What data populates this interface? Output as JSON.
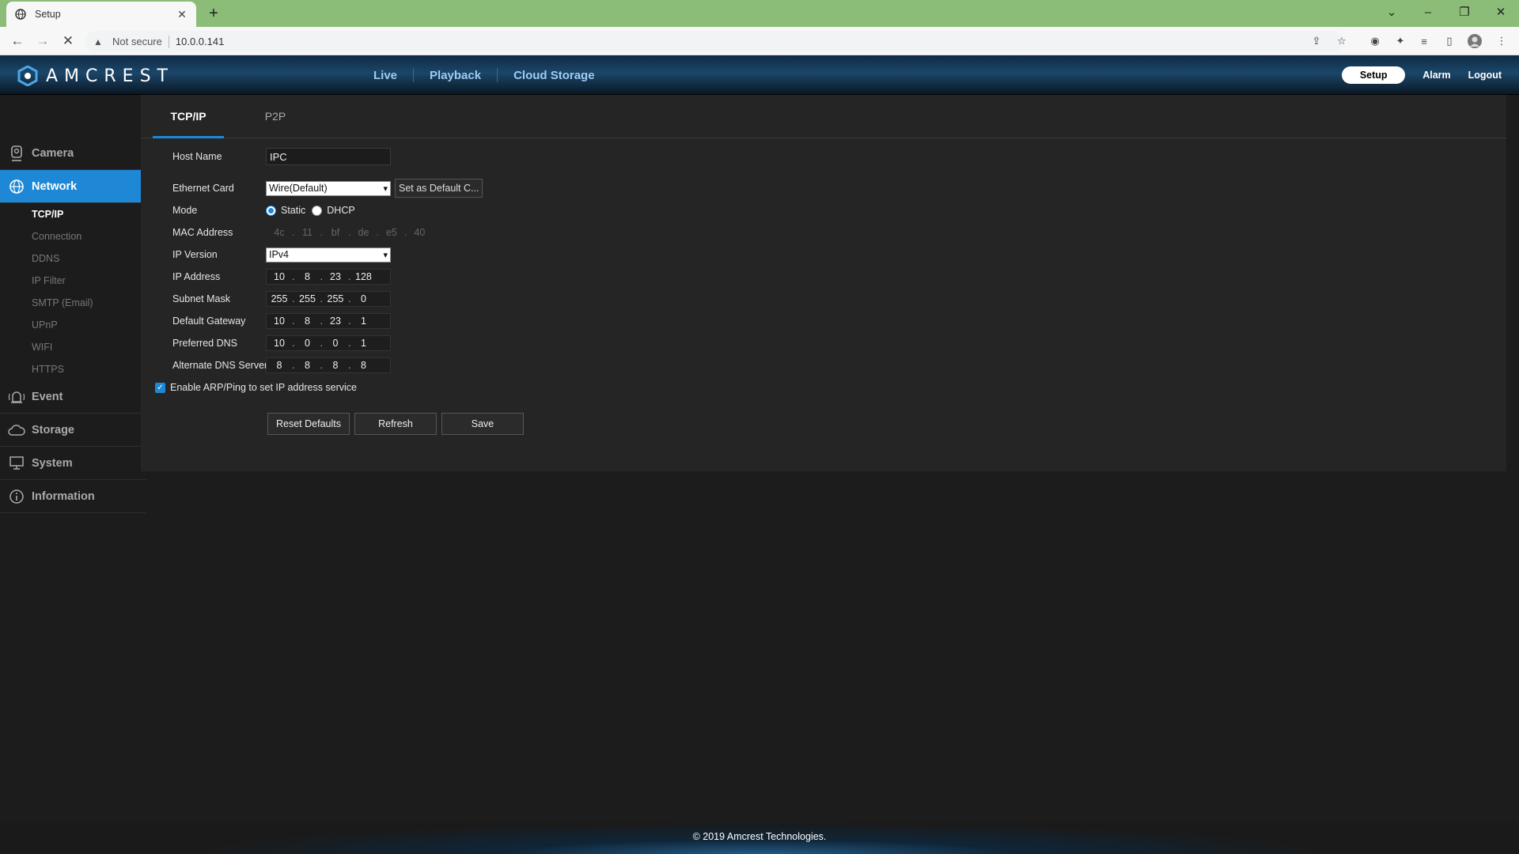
{
  "browser": {
    "tab_title": "Setup",
    "not_secure": "Not secure",
    "url": "10.0.0.141"
  },
  "header": {
    "brand": "AMCREST",
    "nav": [
      "Live",
      "Playback",
      "Cloud Storage"
    ],
    "setup": "Setup",
    "alarm": "Alarm",
    "logout": "Logout"
  },
  "sidebar": {
    "camera": "Camera",
    "network": "Network",
    "network_items": [
      "TCP/IP",
      "Connection",
      "DDNS",
      "IP Filter",
      "SMTP (Email)",
      "UPnP",
      "WIFI",
      "HTTPS"
    ],
    "event": "Event",
    "storage": "Storage",
    "system": "System",
    "information": "Information"
  },
  "tabs": [
    "TCP/IP",
    "P2P"
  ],
  "form": {
    "host_name_label": "Host Name",
    "host_name": "IPC",
    "ethernet_label": "Ethernet Card",
    "ethernet_value": "Wire(Default)",
    "set_default": "Set as Default C...",
    "mode_label": "Mode",
    "mode_static": "Static",
    "mode_dhcp": "DHCP",
    "mac_label": "MAC Address",
    "mac": [
      "4c",
      "11",
      "bf",
      "de",
      "e5",
      "40"
    ],
    "ip_version_label": "IP Version",
    "ip_version": "IPv4",
    "ip_label": "IP Address",
    "ip": [
      "10",
      "8",
      "23",
      "128"
    ],
    "subnet_label": "Subnet Mask",
    "subnet": [
      "255",
      "255",
      "255",
      "0"
    ],
    "gateway_label": "Default Gateway",
    "gateway": [
      "10",
      "8",
      "23",
      "1"
    ],
    "pdns_label": "Preferred DNS",
    "pdns": [
      "10",
      "0",
      "0",
      "1"
    ],
    "adns_label": "Alternate DNS Server",
    "adns": [
      "8",
      "8",
      "8",
      "8"
    ],
    "arp_label": "Enable ARP/Ping to set IP address service"
  },
  "buttons": {
    "reset": "Reset Defaults",
    "refresh": "Refresh",
    "save": "Save"
  },
  "footer": "© 2019 Amcrest Technologies.",
  "colors": {
    "accent": "#1e88d6",
    "background": "#1c1c1c",
    "panel": "#252525"
  }
}
